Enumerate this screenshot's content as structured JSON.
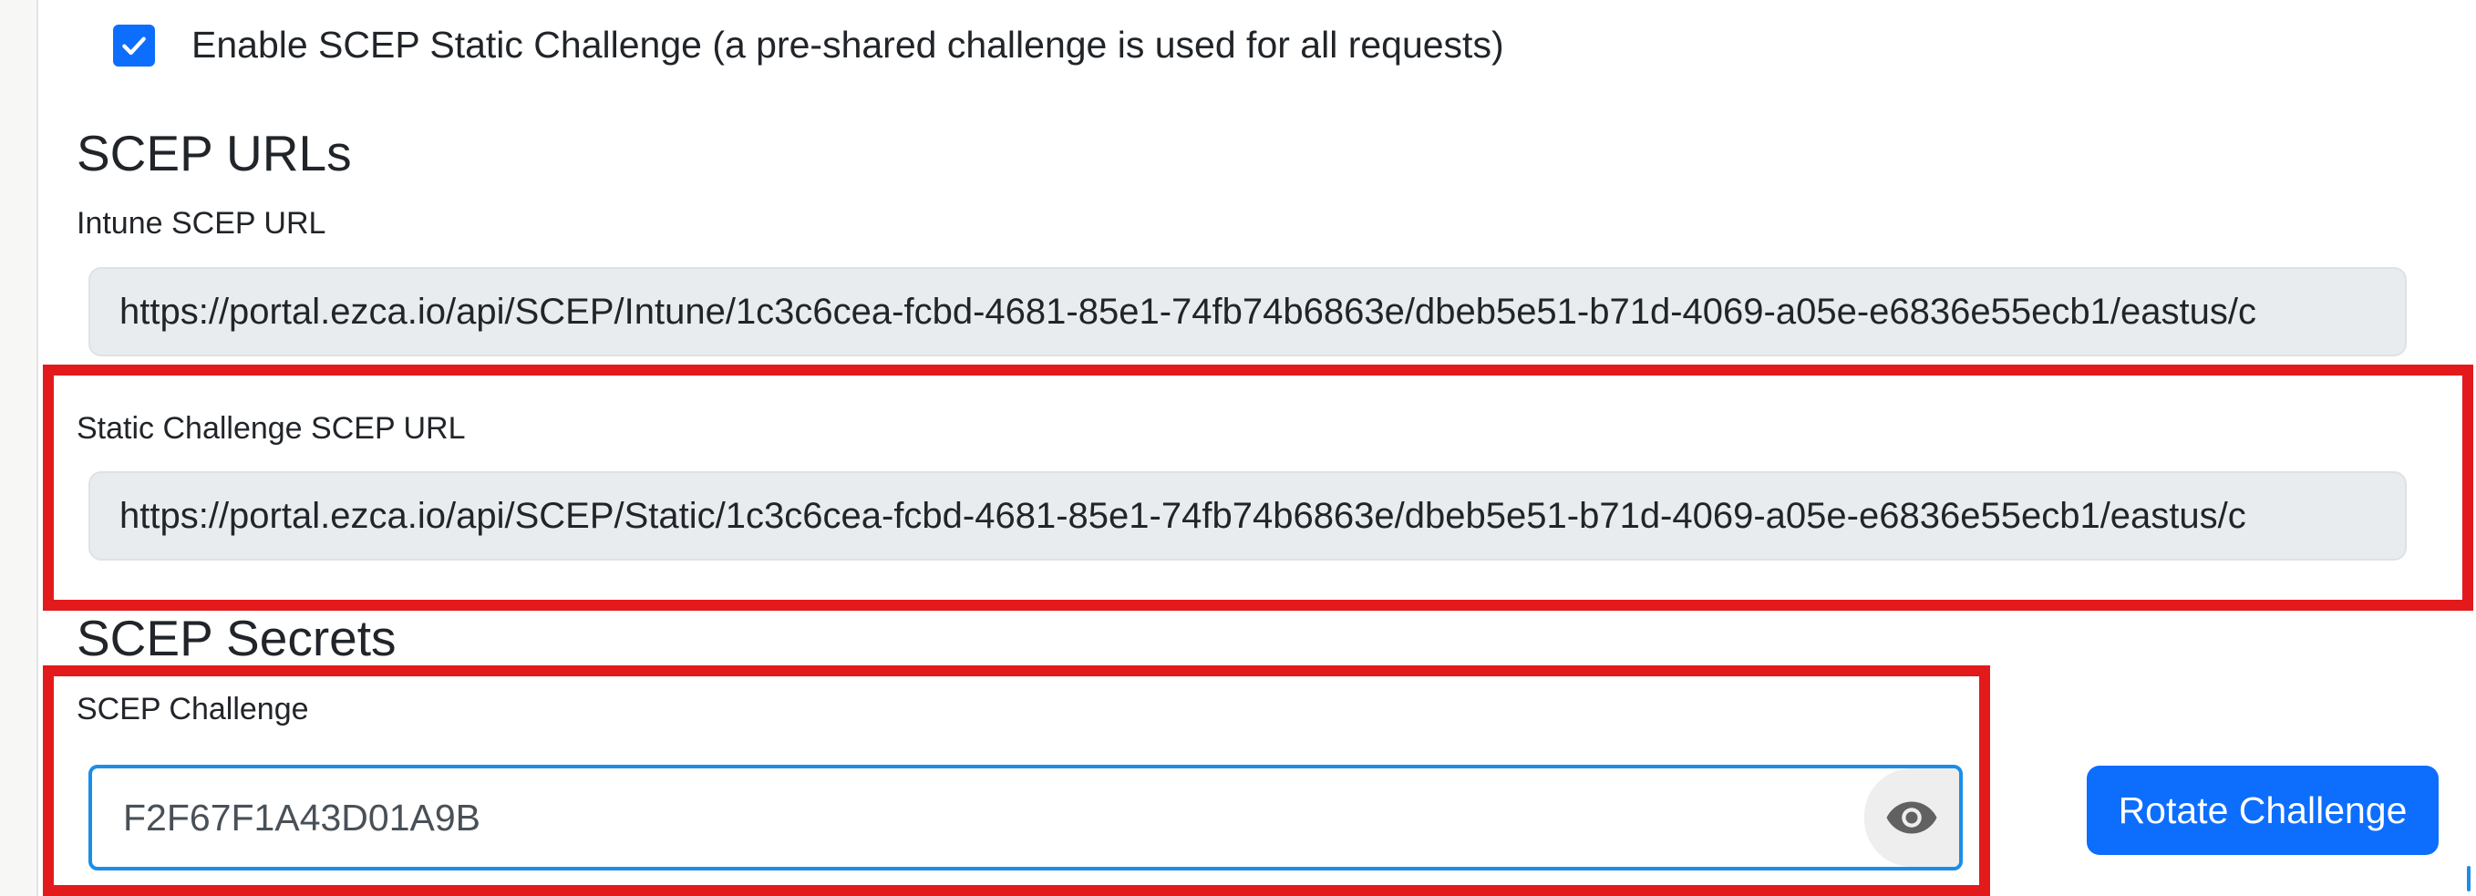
{
  "static_challenge_toggle": {
    "checked": true,
    "label": "Enable SCEP Static Challenge (a pre-shared challenge is used for all requests)"
  },
  "scep_urls": {
    "heading": "SCEP URLs",
    "intune": {
      "label": "Intune SCEP URL",
      "value": "https://portal.ezca.io/api/SCEP/Intune/1c3c6cea-fcbd-4681-85e1-74fb74b6863e/dbeb5e51-b71d-4069-a05e-e6836e55ecb1/eastus/c"
    },
    "static": {
      "label": "Static Challenge SCEP URL",
      "value": "https://portal.ezca.io/api/SCEP/Static/1c3c6cea-fcbd-4681-85e1-74fb74b6863e/dbeb5e51-b71d-4069-a05e-e6836e55ecb1/eastus/c"
    }
  },
  "scep_secrets": {
    "heading": "SCEP Secrets",
    "challenge": {
      "label": "SCEP Challenge",
      "value": "F2F67F1A43D01A9B",
      "reveal_icon": "eye-icon"
    },
    "rotate_label": "Rotate Challenge"
  },
  "colors": {
    "primary": "#0d6efd",
    "highlight": "#e31a1c",
    "field_background": "#e9ecef",
    "focus_border": "#1a8ee8"
  }
}
